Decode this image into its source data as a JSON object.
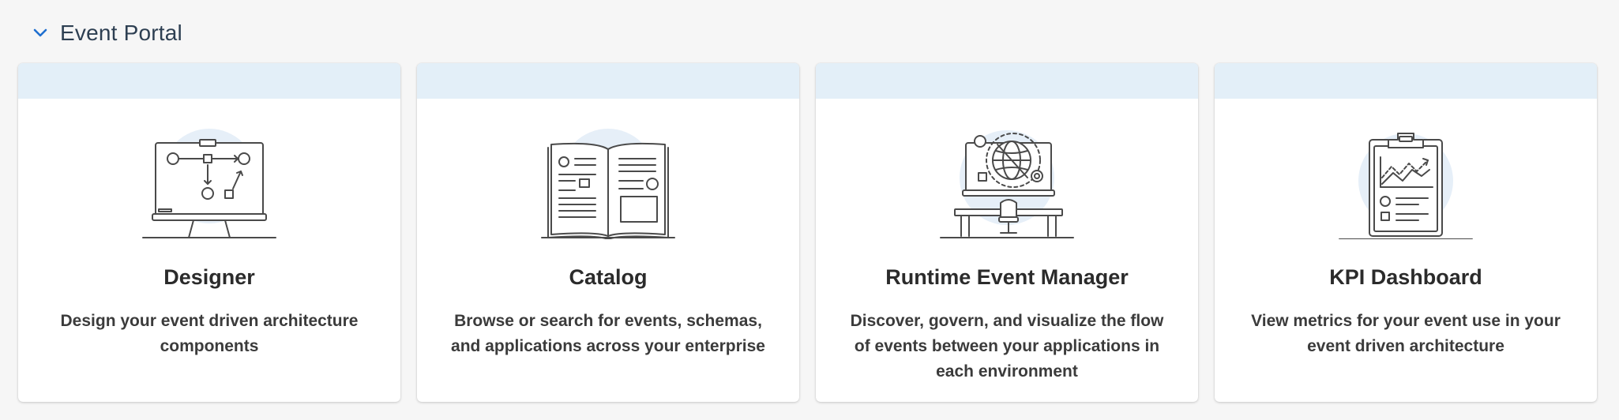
{
  "section": {
    "title": "Event Portal"
  },
  "cards": [
    {
      "title": "Designer",
      "description": "Design your event driven architecture components",
      "icon": "whiteboard-diagram-icon"
    },
    {
      "title": "Catalog",
      "description": "Browse or search for events, schemas, and applications across your enterprise",
      "icon": "open-book-icon"
    },
    {
      "title": "Runtime Event Manager",
      "description": "Discover, govern, and visualize the flow of events between your applications in each environment",
      "icon": "desk-globe-monitor-icon"
    },
    {
      "title": "KPI Dashboard",
      "description": "View metrics for your event use in your event driven architecture",
      "icon": "clipboard-chart-icon"
    }
  ],
  "colors": {
    "band": "#e3eff8",
    "accent": "#1f6fd0",
    "page_bg": "#f6f6f6"
  }
}
